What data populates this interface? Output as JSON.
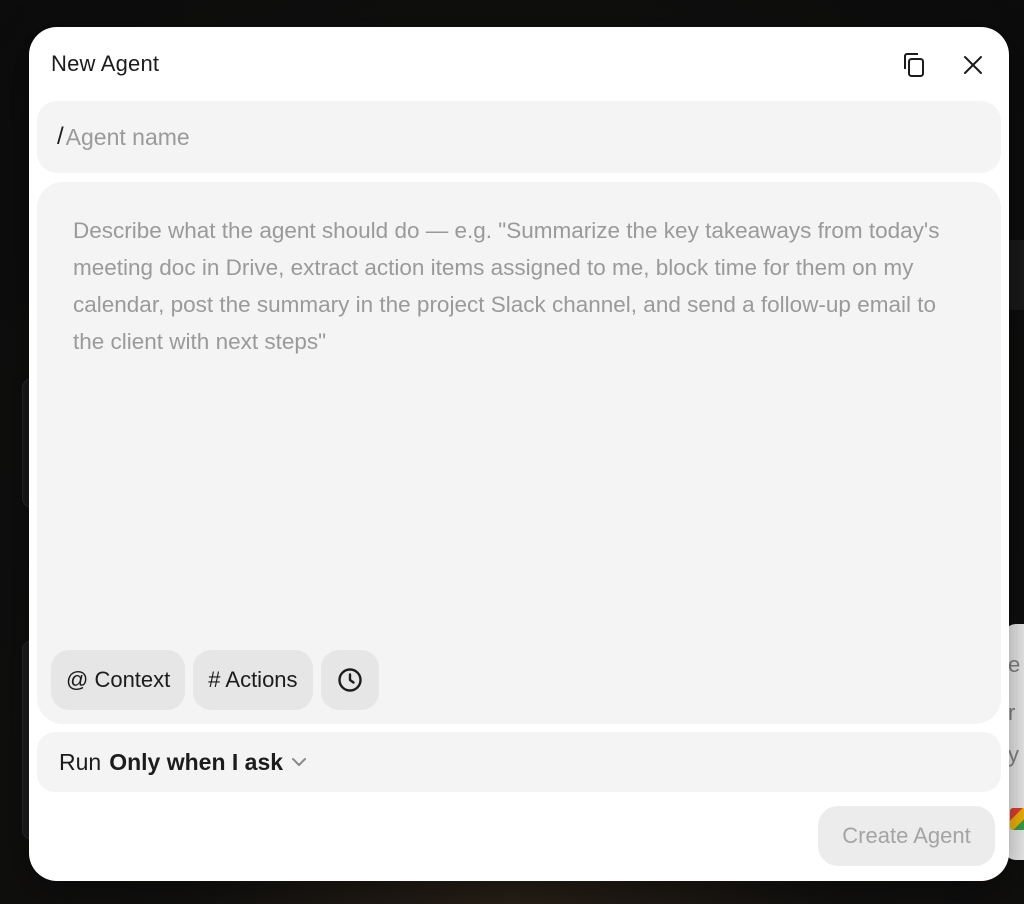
{
  "dialog": {
    "title": "New Agent",
    "icons": {
      "copy": "copy-icon",
      "close": "close-icon"
    }
  },
  "name_field": {
    "prefix": "/",
    "value": "",
    "placeholder": "Agent name"
  },
  "description": {
    "value": "",
    "placeholder": "Describe what the agent should do — e.g. \"Summarize the key takeaways from today's meeting doc in Drive, extract action items assigned to me, block time for them on my calendar, post the summary in the project Slack channel, and send a follow-up email to the client with next steps\""
  },
  "chips": {
    "context": "@ Context",
    "actions": "# Actions",
    "schedule_icon": "clock-icon"
  },
  "run": {
    "label": "Run",
    "value": "Only when I ask",
    "icon": "chevron-down-icon"
  },
  "footer": {
    "create_label": "Create Agent"
  },
  "colors": {
    "surface": "#ffffff",
    "field_bg": "#f4f4f4",
    "chip_bg": "#e6e6e6",
    "placeholder": "#9a9a9a",
    "text": "#1c1c1c",
    "disabled_text": "#a4a4a4"
  }
}
